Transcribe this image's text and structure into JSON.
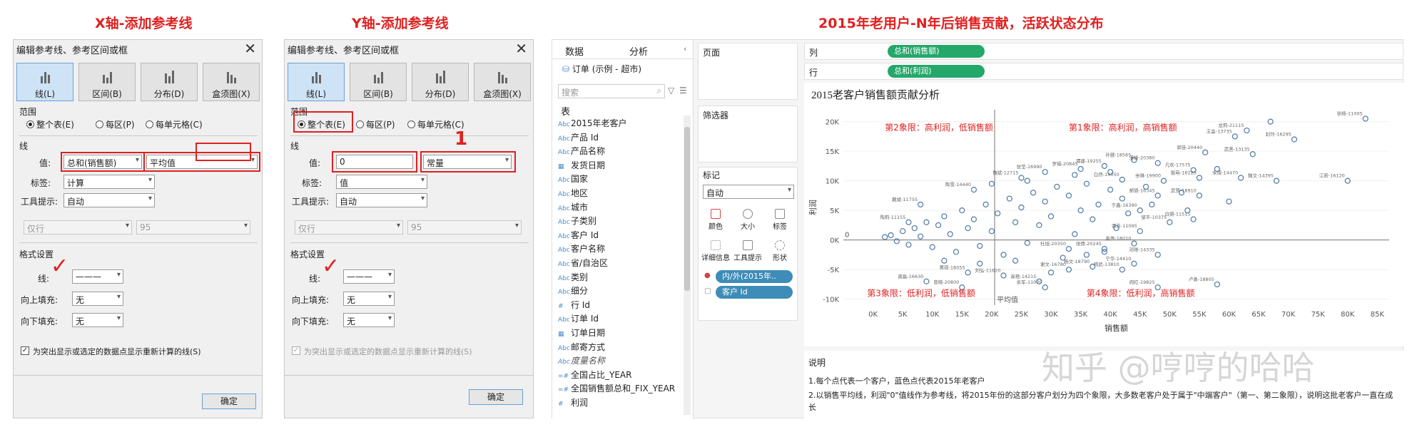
{
  "titles": {
    "x_axis": "X轴-添加参考线",
    "y_axis": "Y轴-添加参考线",
    "main": "2015年老用户-N年后销售贡献，活跃状态分布"
  },
  "dialog_common": {
    "title": "编辑参考线、参考区间或框",
    "close": "✕",
    "tabs": [
      "线(L)",
      "区间(B)",
      "分布(D)",
      "盒须图(X)"
    ],
    "scope_label": "范围",
    "scope_options": [
      "整个表(E)",
      "每区(P)",
      "每单元格(C)"
    ],
    "line_section": "线",
    "value_label": "值:",
    "tag_label": "标签:",
    "tooltip_label": "工具提示:",
    "tooltip_value": "自动",
    "format_section": "格式设置",
    "line_label": "线:",
    "fill_up_label": "向上填充:",
    "fill_down_label": "向下填充:",
    "fill_value": "无",
    "only_value": "仅行",
    "pct_value": "95",
    "checkbox_label": "为突出显示或选定的数据点显示重新计算的线(S)",
    "ok": "确定"
  },
  "dialog_x": {
    "value_field": "总和(销售额)",
    "agg": "平均值",
    "tag_value": "计算"
  },
  "dialog_y": {
    "value_field": "0",
    "agg": "常量",
    "tag_value": "值",
    "annotation": "1"
  },
  "tableau": {
    "tabs": [
      "数据",
      "分析"
    ],
    "datasource": "订单 (示例 - 超市)",
    "search_placeholder": "搜索",
    "table_header": "表",
    "fields": [
      "2015年老客户",
      "产品 Id",
      "产品名称",
      "发货日期",
      "国家",
      "地区",
      "城市",
      "子类别",
      "客户 Id",
      "客户名称",
      "省/自治区",
      "类别",
      "细分",
      "行 Id",
      "订单 Id",
      "订单日期",
      "邮寄方式",
      "度量名称",
      "全国占比_YEAR",
      "全国销售额总和_FIX_YEAR",
      "利润"
    ],
    "pages_label": "页面",
    "filters_label": "筛选器",
    "marks_label": "标记",
    "marks_type": "自动",
    "mark_buttons": [
      "颜色",
      "大小",
      "标签",
      "详细信息",
      "工具提示",
      "形状"
    ],
    "mark_pills": [
      "内/外(2015年..",
      "客户 Id"
    ],
    "columns_label": "列",
    "rows_label": "行",
    "columns_pill": "总和(销售额)",
    "rows_pill": "总和(利润)",
    "description_label": "说明",
    "description_lines": [
      "1.每个点代表一个客户，蓝色点代表2015年老客户",
      "2.以销售平均线，利润\"0\"值线作为参考线，将2015年份的这部分客户划分为四个象限，大多数老客户处于属于\"中端客户\"（第一、第二象限），说明这批老客户一直在成长"
    ]
  },
  "watermark": "知乎 @哼哼的哈哈",
  "colors": {
    "accent_red": "#e02020",
    "pill_green": "#24a86a",
    "pill_blue": "#3e8cb8",
    "point_blue": "#4e79a7"
  },
  "chart_data": {
    "type": "scatter",
    "title": "2015老客户销售额贡献分析",
    "xlabel": "销售额",
    "ylabel": "利润",
    "xlim": [
      -5000,
      87000
    ],
    "ylim": [
      -11000,
      22000
    ],
    "x_ticks": [
      "0K",
      "5K",
      "10K",
      "15K",
      "20K",
      "25K",
      "30K",
      "35K",
      "40K",
      "45K",
      "50K",
      "55K",
      "60K",
      "65K",
      "70K",
      "75K",
      "80K",
      "85K"
    ],
    "y_ticks": [
      "20K",
      "15K",
      "10K",
      "5K",
      "0K",
      "-5K",
      "-10K"
    ],
    "ref_line_x": 20500,
    "ref_line_x_label": "平均值",
    "ref_line_y": 0,
    "ref_line_y_label": "0",
    "quadrant_labels": [
      {
        "text": "第2象限：高利润，低销售额",
        "x": 2000,
        "y": 18500
      },
      {
        "text": "第1象限：高利润，高销售额",
        "x": 33000,
        "y": 18500
      },
      {
        "text": "第3象限：低利润，低销售额",
        "x": -1000,
        "y": -9500
      },
      {
        "text": "第4象限：低利润，高销售额",
        "x": 36000,
        "y": -9500
      }
    ],
    "points": [
      {
        "x": 83000,
        "y": 20500,
        "label": "徐杨-11005"
      },
      {
        "x": 67000,
        "y": 20000,
        "label": ""
      },
      {
        "x": 63000,
        "y": 18500,
        "label": "龙莉-21115"
      },
      {
        "x": 61000,
        "y": 17500,
        "label": "王淼-13735"
      },
      {
        "x": 71000,
        "y": 17000,
        "label": "封玲-16295"
      },
      {
        "x": 64000,
        "y": 14500,
        "label": "武善-13135"
      },
      {
        "x": 56000,
        "y": 14800,
        "label": "郭佳-20440"
      },
      {
        "x": 44000,
        "y": 13500,
        "label": "孙健-18565"
      },
      {
        "x": 48000,
        "y": 13000,
        "label": "潘锋-20380"
      },
      {
        "x": 39000,
        "y": 12500,
        "label": "谭建-19255"
      },
      {
        "x": 35000,
        "y": 12000,
        "label": "罗娟-20845"
      },
      {
        "x": 29000,
        "y": 11500,
        "label": "张莹-16990"
      },
      {
        "x": 25000,
        "y": 10500,
        "label": "魏斌-12715"
      },
      {
        "x": 54000,
        "y": 11800,
        "label": "凡欢-17575"
      },
      {
        "x": 55000,
        "y": 10500,
        "label": "殷萌-16225"
      },
      {
        "x": 62000,
        "y": 10500,
        "label": "宋倩-14470"
      },
      {
        "x": 68000,
        "y": 10000,
        "label": "魏文-14395"
      },
      {
        "x": 80000,
        "y": 10000,
        "label": "江新-16120"
      },
      {
        "x": 49000,
        "y": 10000,
        "label": "余琳-19900"
      },
      {
        "x": 42000,
        "y": 10200,
        "label": "白然-14050"
      },
      {
        "x": 48000,
        "y": 7500,
        "label": "郝倩-16345"
      },
      {
        "x": 55000,
        "y": 7500,
        "label": "武梦-18910"
      },
      {
        "x": 17000,
        "y": 8500,
        "label": "陶雪-14440"
      },
      {
        "x": 8000,
        "y": 6000,
        "label": "戴斌-11755"
      },
      {
        "x": 45000,
        "y": 5000,
        "label": "于鑫-16390"
      },
      {
        "x": 54000,
        "y": 3500,
        "label": "白娟-11515"
      },
      {
        "x": 6000,
        "y": 3000,
        "label": "陶莉-11155"
      },
      {
        "x": 50000,
        "y": 3000,
        "label": "邹平-10375"
      },
      {
        "x": 45000,
        "y": 1500,
        "label": "谭芳-11095"
      },
      {
        "x": 44000,
        "y": -600,
        "label": "姜伟-18010"
      },
      {
        "x": 48000,
        "y": -2500,
        "label": "邓晓-14335"
      },
      {
        "x": 44000,
        "y": -4000,
        "label": "宁华-14410"
      },
      {
        "x": 33000,
        "y": -1500,
        "label": "杜旭-20350"
      },
      {
        "x": 39000,
        "y": -1500,
        "label": "张倩-20245"
      },
      {
        "x": 37000,
        "y": -4500,
        "label": "杨文-18790"
      },
      {
        "x": 33000,
        "y": -5000,
        "label": "谢文-16780"
      },
      {
        "x": 42000,
        "y": -5000,
        "label": "韩武-13810"
      },
      {
        "x": 16000,
        "y": -5500,
        "label": "黄硕-18055"
      },
      {
        "x": 22000,
        "y": -6000,
        "label": "刘弘-11620"
      },
      {
        "x": 28000,
        "y": -7000,
        "label": "高艳-14215"
      },
      {
        "x": 9000,
        "y": -7000,
        "label": "龚磊-16630"
      },
      {
        "x": 15000,
        "y": -8000,
        "label": "曾晓-20800"
      },
      {
        "x": 29000,
        "y": -8000,
        "label": "余军-11020"
      },
      {
        "x": 48000,
        "y": -8000,
        "label": "阎红-19825"
      },
      {
        "x": 58000,
        "y": -7500,
        "label": "卢勇-18805"
      },
      {
        "x": 2000,
        "y": 500,
        "label": ""
      },
      {
        "x": 3000,
        "y": 800,
        "label": ""
      },
      {
        "x": 4000,
        "y": -200,
        "label": ""
      },
      {
        "x": 5000,
        "y": 1500,
        "label": ""
      },
      {
        "x": 6000,
        "y": -800,
        "label": ""
      },
      {
        "x": 7000,
        "y": 2000,
        "label": ""
      },
      {
        "x": 8000,
        "y": 600,
        "label": ""
      },
      {
        "x": 9000,
        "y": 3000,
        "label": ""
      },
      {
        "x": 10000,
        "y": -1200,
        "label": ""
      },
      {
        "x": 11000,
        "y": 2500,
        "label": ""
      },
      {
        "x": 12000,
        "y": 4000,
        "label": ""
      },
      {
        "x": 13000,
        "y": 1000,
        "label": ""
      },
      {
        "x": 14000,
        "y": -2000,
        "label": ""
      },
      {
        "x": 15000,
        "y": 5000,
        "label": ""
      },
      {
        "x": 16000,
        "y": 2000,
        "label": ""
      },
      {
        "x": 17000,
        "y": 3500,
        "label": ""
      },
      {
        "x": 18000,
        "y": -1000,
        "label": ""
      },
      {
        "x": 19000,
        "y": 6000,
        "label": ""
      },
      {
        "x": 20000,
        "y": 1500,
        "label": ""
      },
      {
        "x": 21000,
        "y": 4500,
        "label": ""
      },
      {
        "x": 22000,
        "y": -2500,
        "label": ""
      },
      {
        "x": 23000,
        "y": 7000,
        "label": ""
      },
      {
        "x": 24000,
        "y": 3000,
        "label": ""
      },
      {
        "x": 25000,
        "y": 5500,
        "label": ""
      },
      {
        "x": 26000,
        "y": -500,
        "label": ""
      },
      {
        "x": 27000,
        "y": 8000,
        "label": ""
      },
      {
        "x": 28000,
        "y": 2500,
        "label": ""
      },
      {
        "x": 29000,
        "y": 6500,
        "label": ""
      },
      {
        "x": 30000,
        "y": 4000,
        "label": ""
      },
      {
        "x": 31000,
        "y": 9000,
        "label": ""
      },
      {
        "x": 32000,
        "y": -3000,
        "label": ""
      },
      {
        "x": 33000,
        "y": 7500,
        "label": ""
      },
      {
        "x": 34000,
        "y": 1000,
        "label": ""
      },
      {
        "x": 35000,
        "y": 5000,
        "label": ""
      },
      {
        "x": 36000,
        "y": 9500,
        "label": ""
      },
      {
        "x": 37000,
        "y": 3500,
        "label": ""
      },
      {
        "x": 38000,
        "y": 6000,
        "label": ""
      },
      {
        "x": 39000,
        "y": -2000,
        "label": ""
      },
      {
        "x": 40000,
        "y": 8500,
        "label": ""
      },
      {
        "x": 41000,
        "y": 2000,
        "label": ""
      },
      {
        "x": 42000,
        "y": 7000,
        "label": ""
      },
      {
        "x": 43000,
        "y": 4500,
        "label": ""
      },
      {
        "x": 46000,
        "y": 9000,
        "label": ""
      },
      {
        "x": 47000,
        "y": 6000,
        "label": ""
      },
      {
        "x": 52000,
        "y": 8000,
        "label": ""
      },
      {
        "x": 53000,
        "y": 5000,
        "label": ""
      },
      {
        "x": 58000,
        "y": 12000,
        "label": ""
      },
      {
        "x": 60000,
        "y": 6500,
        "label": ""
      },
      {
        "x": 12000,
        "y": -3500,
        "label": ""
      },
      {
        "x": 18000,
        "y": -4000,
        "label": ""
      },
      {
        "x": 24000,
        "y": -3500,
        "label": ""
      },
      {
        "x": 30000,
        "y": -5500,
        "label": ""
      },
      {
        "x": 36000,
        "y": -2500,
        "label": ""
      },
      {
        "x": 20000,
        "y": 9500,
        "label": ""
      },
      {
        "x": 26000,
        "y": 10000,
        "label": ""
      },
      {
        "x": 34000,
        "y": 11000,
        "label": ""
      },
      {
        "x": 40000,
        "y": 11500,
        "label": ""
      }
    ]
  }
}
